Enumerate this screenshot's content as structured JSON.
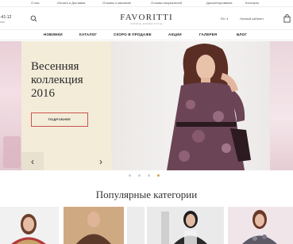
{
  "topbar": {
    "links": [
      "О нас",
      "Оплата и Доставка",
      "Отзывы о магазине",
      "Отзывы покупателей",
      "Дисконтирование",
      "Контакты"
    ]
  },
  "header": {
    "phone": "-41-12",
    "phone_sub": "ная",
    "logo": "FAVORITTI",
    "tagline": "STRONG WOMEN STYLE",
    "lang": "RU",
    "cabinet": "Личный кабинет"
  },
  "nav": {
    "items": [
      "НОВИНКИ",
      "КАТАЛОГ",
      "СКОРО В ПРОДАЖЕ",
      "АКЦИИ",
      "ГАЛЕРЕЯ",
      "БЛОГ"
    ]
  },
  "hero": {
    "title_lines": [
      "Весенняя",
      "коллекция",
      "2016"
    ],
    "button_label": "ПОДРОБНЕЕ",
    "prev_arrow": "‹",
    "next_arrow": "›"
  },
  "slider": {
    "dots_count": 4,
    "active_dot": 3
  },
  "categories": {
    "title": "Популярные категории"
  },
  "colors": {
    "accent_button_border": "#c9554d",
    "panel_bg": "#f3ecd9",
    "active_dot": "#d9a14d"
  }
}
